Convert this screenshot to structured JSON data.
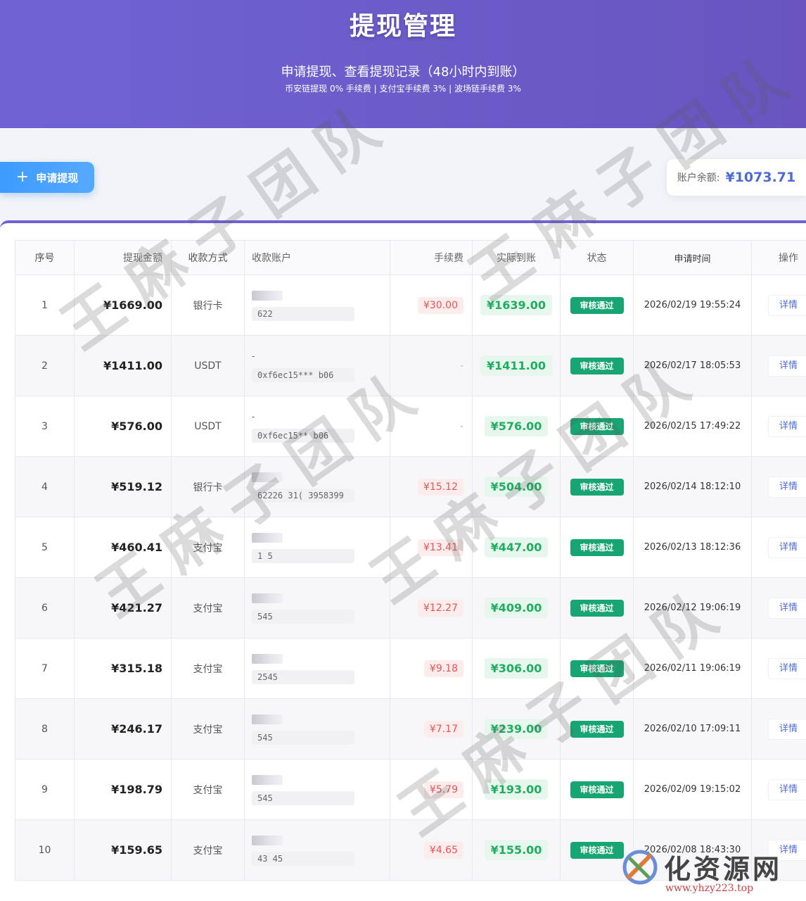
{
  "header": {
    "title": "提现管理",
    "subtitle": "申请提现、查看提现记录（48小时内到账）",
    "fees": "币安链提现 0% 手续费 | 支付宝手续费 3% | 波场链手续费 3%"
  },
  "toolbar": {
    "apply_label": "申请提现",
    "plus_icon": "+",
    "balance_label": "账户余额:",
    "balance_value": "¥1073.71"
  },
  "table": {
    "columns": [
      "序号",
      "提现金额",
      "收款方式",
      "收款账户",
      "手续费",
      "实际到账",
      "状态",
      "申请时间",
      "操作"
    ],
    "rows": [
      {
        "idx": "1",
        "amount": "¥1669.00",
        "method": "银行卡",
        "acct_name": "",
        "acct_no": "622",
        "fee": "¥30.00",
        "net": "¥1639.00",
        "status": "审核通过",
        "time": "2026/02/19 19:55:24",
        "op": "详情"
      },
      {
        "idx": "2",
        "amount": "¥1411.00",
        "method": "USDT",
        "acct_name": "-",
        "acct_no": "0xf6ec15***   b06",
        "fee": "-",
        "net": "¥1411.00",
        "status": "审核通过",
        "time": "2026/02/17 18:05:53",
        "op": "详情"
      },
      {
        "idx": "3",
        "amount": "¥576.00",
        "method": "USDT",
        "acct_name": "-",
        "acct_no": "0xf6ec15**    b06",
        "fee": "-",
        "net": "¥576.00",
        "status": "审核通过",
        "time": "2026/02/15 17:49:22",
        "op": "详情"
      },
      {
        "idx": "4",
        "amount": "¥519.12",
        "method": "银行卡",
        "acct_name": "",
        "acct_no": "62226   31(  3958399",
        "fee": "¥15.12",
        "net": "¥504.00",
        "status": "审核通过",
        "time": "2026/02/14 18:12:10",
        "op": "详情"
      },
      {
        "idx": "5",
        "amount": "¥460.41",
        "method": "支付宝",
        "acct_name": "",
        "acct_no": "1       5",
        "fee": "¥13.41",
        "net": "¥447.00",
        "status": "审核通过",
        "time": "2026/02/13 18:12:36",
        "op": "详情"
      },
      {
        "idx": "6",
        "amount": "¥421.27",
        "method": "支付宝",
        "acct_name": "",
        "acct_no": "       545",
        "fee": "¥12.27",
        "net": "¥409.00",
        "status": "审核通过",
        "time": "2026/02/12 19:06:19",
        "op": "详情"
      },
      {
        "idx": "7",
        "amount": "¥315.18",
        "method": "支付宝",
        "acct_name": "",
        "acct_no": "      2545",
        "fee": "¥9.18",
        "net": "¥306.00",
        "status": "审核通过",
        "time": "2026/02/11 19:06:19",
        "op": "详情"
      },
      {
        "idx": "8",
        "amount": "¥246.17",
        "method": "支付宝",
        "acct_name": "",
        "acct_no": "       545",
        "fee": "¥7.17",
        "net": "¥239.00",
        "status": "审核通过",
        "time": "2026/02/10 17:09:11",
        "op": "详情"
      },
      {
        "idx": "9",
        "amount": "¥198.79",
        "method": "支付宝",
        "acct_name": "",
        "acct_no": "       545",
        "fee": "¥5.79",
        "net": "¥193.00",
        "status": "审核通过",
        "time": "2026/02/09 19:15:02",
        "op": "详情"
      },
      {
        "idx": "10",
        "amount": "¥159.65",
        "method": "支付宝",
        "acct_name": "",
        "acct_no": "43    45",
        "fee": "¥4.65",
        "net": "¥155.00",
        "status": "审核通过",
        "time": "2026/02/08 18:43:30",
        "op": "详情"
      }
    ]
  },
  "watermark": {
    "text": "王麻子团队"
  },
  "brand": {
    "name": "化资源网",
    "url": "www.yhzy223.top"
  },
  "colors": {
    "header": "#6f63d4",
    "accent_blue": "#409eff",
    "status_green": "#17a673",
    "fee_red": "#e45656",
    "net_green": "#1fae5f"
  }
}
